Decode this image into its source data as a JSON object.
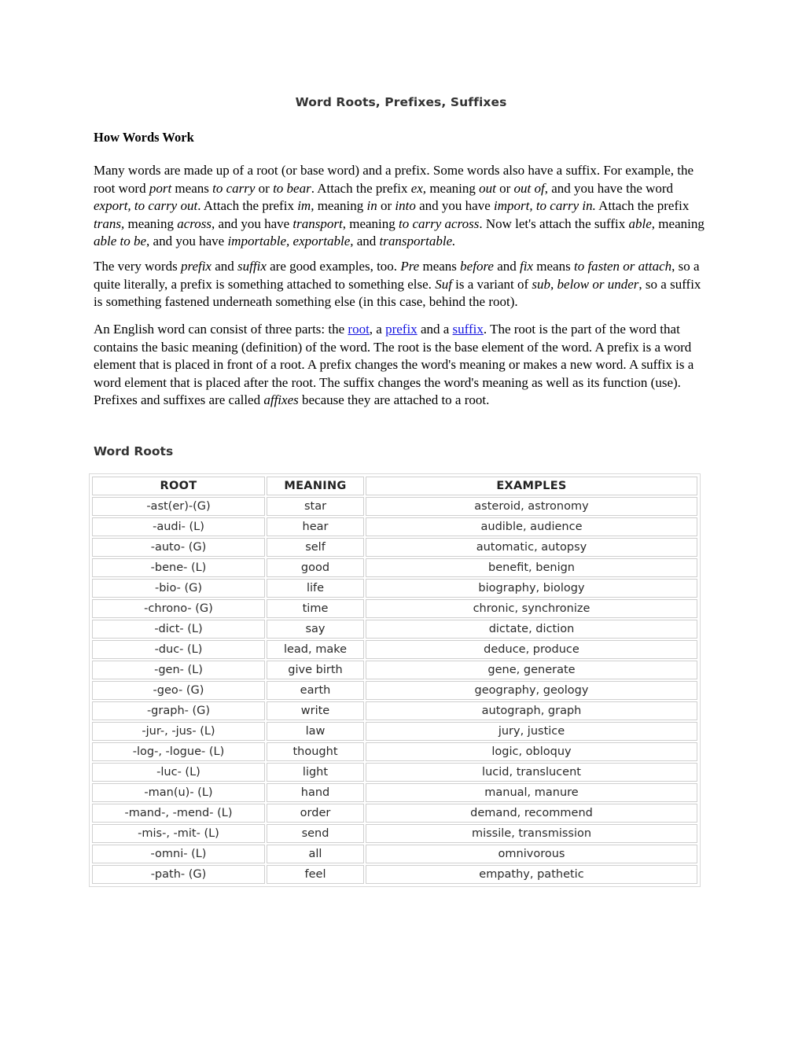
{
  "document": {
    "title": "Word Roots, Prefixes, Suffixes",
    "section1_heading": "How Words Work",
    "section2_heading": "Word Roots",
    "link_color": "#1414e0",
    "heading_color": "#333333",
    "border_color": "#cfcfcf",
    "paragraph1": {
      "full_text": "Many words are made up of a root (or base word) and a prefix. Some words also have a suffix. For example, the root word port means to carry or to bear. Attach the prefix ex, meaning out or out of, and you have the word export, to carry out. Attach the prefix im, meaning in or into and you have import, to carry in. Attach the prefix trans, meaning across, and you have transport, meaning to carry across. Now let's attach the suffix able, meaning able to be, and you have importable, exportable, and transportable.",
      "runs": [
        {
          "t": "Many words are made up of a root (or base word) and a prefix. Some words also have a suffix. For example, the root word ",
          "s": "normal"
        },
        {
          "t": "port",
          "s": "italic"
        },
        {
          "t": " means ",
          "s": "normal"
        },
        {
          "t": "to carry",
          "s": "italic"
        },
        {
          "t": " or ",
          "s": "normal"
        },
        {
          "t": "to bear",
          "s": "italic"
        },
        {
          "t": ". Attach the prefix ",
          "s": "normal"
        },
        {
          "t": "ex,",
          "s": "italic"
        },
        {
          "t": " meaning ",
          "s": "normal"
        },
        {
          "t": "out",
          "s": "italic"
        },
        {
          "t": " or ",
          "s": "normal"
        },
        {
          "t": "out of",
          "s": "italic"
        },
        {
          "t": ", and you have the word ",
          "s": "normal"
        },
        {
          "t": "export, to carry out",
          "s": "italic"
        },
        {
          "t": ". Attach the prefix ",
          "s": "normal"
        },
        {
          "t": "im,",
          "s": "italic"
        },
        {
          "t": " meaning ",
          "s": "normal"
        },
        {
          "t": "in",
          "s": "italic"
        },
        {
          "t": " or ",
          "s": "normal"
        },
        {
          "t": "into",
          "s": "italic"
        },
        {
          "t": " and you have ",
          "s": "normal"
        },
        {
          "t": "import, to carry in.",
          "s": "italic"
        },
        {
          "t": " Attach the prefix ",
          "s": "normal"
        },
        {
          "t": "trans,",
          "s": "italic"
        },
        {
          "t": " meaning ",
          "s": "normal"
        },
        {
          "t": "across",
          "s": "italic"
        },
        {
          "t": ", and you have ",
          "s": "normal"
        },
        {
          "t": "transport",
          "s": "italic"
        },
        {
          "t": ", meaning ",
          "s": "normal"
        },
        {
          "t": "to carry across",
          "s": "italic"
        },
        {
          "t": ". Now let's attach the suffix ",
          "s": "normal"
        },
        {
          "t": "able",
          "s": "italic"
        },
        {
          "t": ", meaning ",
          "s": "normal"
        },
        {
          "t": "able to be",
          "s": "italic"
        },
        {
          "t": ", and you have ",
          "s": "normal"
        },
        {
          "t": "importable, exportable,",
          "s": "italic"
        },
        {
          "t": " and ",
          "s": "normal"
        },
        {
          "t": "transportable.",
          "s": "italic"
        }
      ]
    },
    "paragraph2": {
      "full_text": "The very words prefix and suffix are good examples, too. Pre means before and fix means to fasten or attach, so a quite literally, a prefix is something attached to something else. Suf is a variant of sub, below or under, so a suffix is something fastened underneath something else (in this case, behind the root).",
      "runs": [
        {
          "t": "The very words ",
          "s": "normal"
        },
        {
          "t": "prefix",
          "s": "italic"
        },
        {
          "t": " and ",
          "s": "normal"
        },
        {
          "t": "suffix",
          "s": "italic"
        },
        {
          "t": " are good examples, too. ",
          "s": "normal"
        },
        {
          "t": "Pre",
          "s": "italic"
        },
        {
          "t": " means ",
          "s": "normal"
        },
        {
          "t": "before",
          "s": "italic"
        },
        {
          "t": " and ",
          "s": "normal"
        },
        {
          "t": "fix",
          "s": "italic"
        },
        {
          "t": " means ",
          "s": "normal"
        },
        {
          "t": "to fasten or attach",
          "s": "italic"
        },
        {
          "t": ", so a quite literally, a prefix is something attached to something else. ",
          "s": "normal"
        },
        {
          "t": "Suf",
          "s": "italic"
        },
        {
          "t": " is a variant of ",
          "s": "normal"
        },
        {
          "t": "sub, below or under",
          "s": "italic"
        },
        {
          "t": ", so a suffix is something fastened underneath something else (in this case, behind the root).",
          "s": "normal"
        }
      ]
    },
    "paragraph3": {
      "full_text": "An English word can consist of three parts: the root, a prefix and a suffix. The root is the part of the word that contains the basic meaning (definition) of the word. The root is the base element of the word. A prefix is a word element that is placed in front of a root. A prefix changes the word's meaning or makes a new word. A suffix is a word element that is placed after the root. The suffix changes the word's meaning as well as its function (use). Prefixes and suffixes are called affixes because they are attached to a root.",
      "runs": [
        {
          "t": "An English word can consist of three parts: the ",
          "s": "normal"
        },
        {
          "t": "root",
          "s": "link"
        },
        {
          "t": ", a ",
          "s": "normal"
        },
        {
          "t": "prefix",
          "s": "link"
        },
        {
          "t": " and a ",
          "s": "normal"
        },
        {
          "t": "suffix",
          "s": "link"
        },
        {
          "t": ". The root is the part of the word that contains the basic meaning (definition) of the word. The root is the base element of the word. A prefix is a word element that is placed in front of a root. A prefix changes the word's meaning or makes a new word. A suffix is a word element that is placed after the root. The suffix changes the word's meaning as well as its function (use). Prefixes and suffixes are called ",
          "s": "normal"
        },
        {
          "t": "affixes",
          "s": "italic"
        },
        {
          "t": " because they are attached to a root.",
          "s": "normal"
        }
      ]
    }
  },
  "roots_table": {
    "columns": [
      "ROOT",
      "MEANING",
      "EXAMPLES"
    ],
    "rows": [
      {
        "root": "-ast(er)-(G)",
        "meaning": "star",
        "examples": "asteroid, astronomy"
      },
      {
        "root": "-audi- (L)",
        "meaning": "hear",
        "examples": "audible, audience"
      },
      {
        "root": "-auto- (G)",
        "meaning": "self",
        "examples": "automatic, autopsy"
      },
      {
        "root": "-bene- (L)",
        "meaning": "good",
        "examples": "benefit, benign"
      },
      {
        "root": "-bio- (G)",
        "meaning": "life",
        "examples": "biography, biology"
      },
      {
        "root": "-chrono- (G)",
        "meaning": "time",
        "examples": "chronic, synchronize"
      },
      {
        "root": "-dict- (L)",
        "meaning": "say",
        "examples": "dictate, diction"
      },
      {
        "root": "-duc- (L)",
        "meaning": "lead, make",
        "examples": "deduce, produce"
      },
      {
        "root": "-gen- (L)",
        "meaning": "give birth",
        "examples": "gene, generate"
      },
      {
        "root": "-geo- (G)",
        "meaning": "earth",
        "examples": "geography, geology"
      },
      {
        "root": "-graph- (G)",
        "meaning": "write",
        "examples": "autograph, graph"
      },
      {
        "root": "-jur-, -jus- (L)",
        "meaning": "law",
        "examples": "jury, justice"
      },
      {
        "root": "-log-, -logue- (L)",
        "meaning": "thought",
        "examples": "logic, obloquy"
      },
      {
        "root": "-luc- (L)",
        "meaning": "light",
        "examples": "lucid, translucent"
      },
      {
        "root": "-man(u)- (L)",
        "meaning": "hand",
        "examples": "manual, manure"
      },
      {
        "root": "-mand-, -mend- (L)",
        "meaning": "order",
        "examples": "demand, recommend"
      },
      {
        "root": "-mis-, -mit- (L)",
        "meaning": "send",
        "examples": "missile, transmission"
      },
      {
        "root": "-omni- (L)",
        "meaning": "all",
        "examples": "omnivorous"
      },
      {
        "root": "-path- (G)",
        "meaning": "feel",
        "examples": "empathy, pathetic"
      }
    ]
  }
}
